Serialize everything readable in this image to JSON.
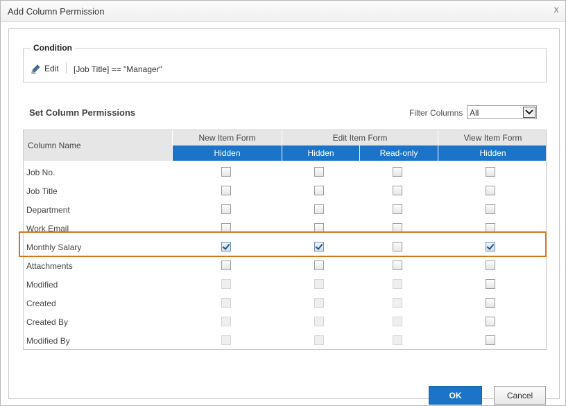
{
  "dialog": {
    "title": "Add Column Permission",
    "close_glyph": "x"
  },
  "condition": {
    "legend": "Condition",
    "edit_label": "Edit",
    "expression": "[Job Title] == \"Manager\""
  },
  "permissions": {
    "section_title": "Set Column Permissions",
    "filter": {
      "label": "Filter Columns",
      "selected": "All"
    },
    "headers": {
      "column_name": "Column Name",
      "groups": [
        "New Item Form",
        "Edit Item Form",
        "View Item Form"
      ],
      "sub": [
        "Hidden",
        "Hidden",
        "Read-only",
        "Hidden"
      ]
    },
    "rows": [
      {
        "name": "Job No.",
        "cells": [
          "unchecked",
          "unchecked",
          "unchecked",
          "unchecked"
        ]
      },
      {
        "name": "Job Title",
        "cells": [
          "unchecked",
          "unchecked",
          "unchecked",
          "unchecked"
        ]
      },
      {
        "name": "Department",
        "cells": [
          "unchecked",
          "unchecked",
          "unchecked",
          "unchecked"
        ]
      },
      {
        "name": "Work Email",
        "cells": [
          "unchecked",
          "unchecked",
          "unchecked",
          "unchecked"
        ]
      },
      {
        "name": "Monthly Salary",
        "cells": [
          "checked",
          "checked",
          "unchecked",
          "checked"
        ],
        "highlighted": true
      },
      {
        "name": "Attachments",
        "cells": [
          "unchecked",
          "unchecked",
          "unchecked",
          "unchecked"
        ]
      },
      {
        "name": "Modified",
        "cells": [
          "disabled",
          "disabled",
          "disabled",
          "unchecked"
        ]
      },
      {
        "name": "Created",
        "cells": [
          "disabled",
          "disabled",
          "disabled",
          "unchecked"
        ]
      },
      {
        "name": "Created By",
        "cells": [
          "disabled",
          "disabled",
          "disabled",
          "unchecked"
        ]
      },
      {
        "name": "Modified By",
        "cells": [
          "disabled",
          "disabled",
          "disabled",
          "unchecked"
        ]
      }
    ]
  },
  "buttons": {
    "ok": "OK",
    "cancel": "Cancel"
  },
  "colors": {
    "accent": "#1b74c8",
    "highlight": "#d9741c",
    "header_gray": "#e6e6e6"
  }
}
